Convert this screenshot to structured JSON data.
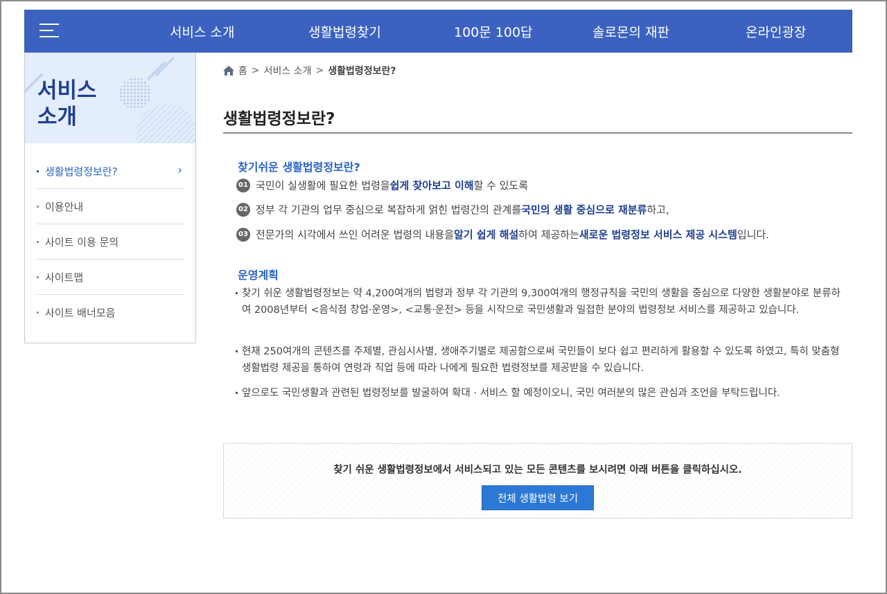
{
  "nav": {
    "items": [
      "서비스 소개",
      "생활법령찾기",
      "100문 100답",
      "솔로몬의 재판",
      "온라인광장"
    ]
  },
  "sidebar": {
    "title_line1": "서비스",
    "title_line2": "소개",
    "items": [
      {
        "label": "생활법령정보란?",
        "active": true
      },
      {
        "label": "이용안내"
      },
      {
        "label": "사이트 이용 문의"
      },
      {
        "label": "사이트맵"
      },
      {
        "label": "사이트 배너모음"
      }
    ]
  },
  "breadcrumb": {
    "home": "홈",
    "sep": ">",
    "level1": "서비스 소개",
    "current": "생활법령정보란?"
  },
  "page_title": "생활법령정보란?",
  "intro": {
    "heading": "찾기쉬운 생활법령정보란?",
    "items": [
      {
        "num": "01",
        "pre": "국민이 실생활에 필요한 법령을 ",
        "hl1": "쉽게 찾아보고 이해",
        "post": "할 수 있도록"
      },
      {
        "num": "02",
        "pre": "정부 각 기관의 업무 중심으로 복잡하게 얽힌 법령간의 관계를 ",
        "hl1": "국민의 생활 중심으로 재분류",
        "post": "하고,"
      },
      {
        "num": "03",
        "pre": "전문가의 시각에서 쓰인 어려운 법령의 내용을 ",
        "hl1": "알기 쉽게 해설",
        "mid": "하여 제공하는 ",
        "hl2": "새로운 법령정보 서비스 제공 시스템",
        "post": "입니다."
      }
    ]
  },
  "plan": {
    "heading": "운영계획",
    "items": [
      "찾기 쉬운 생활법령정보는 약 4,200여개의 법령과 정부 각 기관의 9,300여개의 행정규칙을 국민의 생활을 중심으로 다양한 생활분야로 분류하여 2008년부터 <음식점 창업·운영>, <교통·운전> 등을 시작으로 국민생활과 밀접한 분야의 법령정보 서비스를 제공하고 있습니다.",
      "현재 250여개의 콘텐츠를 주제별, 관심시사별, 생애주기별로 제공함으로써 국민들이 보다 쉽고 편리하게 활용할 수 있도록 하였고, 특히 맞춤형 생활법령 제공을 통하여 연령과 직업 등에 따라 나에게 필요한 법령정보를 제공받을 수 있습니다.",
      "앞으로도 국민생활과 관련된 법령정보를 발굴하여 확대 · 서비스 할 예정이오니, 국민 여러분의 많은 관심과 조언을 부탁드립니다."
    ]
  },
  "notice": {
    "text": "찾기 쉬운 생활법령정보에서 서비스되고 있는 모든 콘텐츠를 보시려면 아래 버튼을 클릭하십시오.",
    "button": "전체 생활법령 보기"
  },
  "colors": {
    "nav_bg": "#3b62c0",
    "accent": "#2a64c4",
    "highlight": "#1f3f8f",
    "button": "#2b78d6"
  }
}
